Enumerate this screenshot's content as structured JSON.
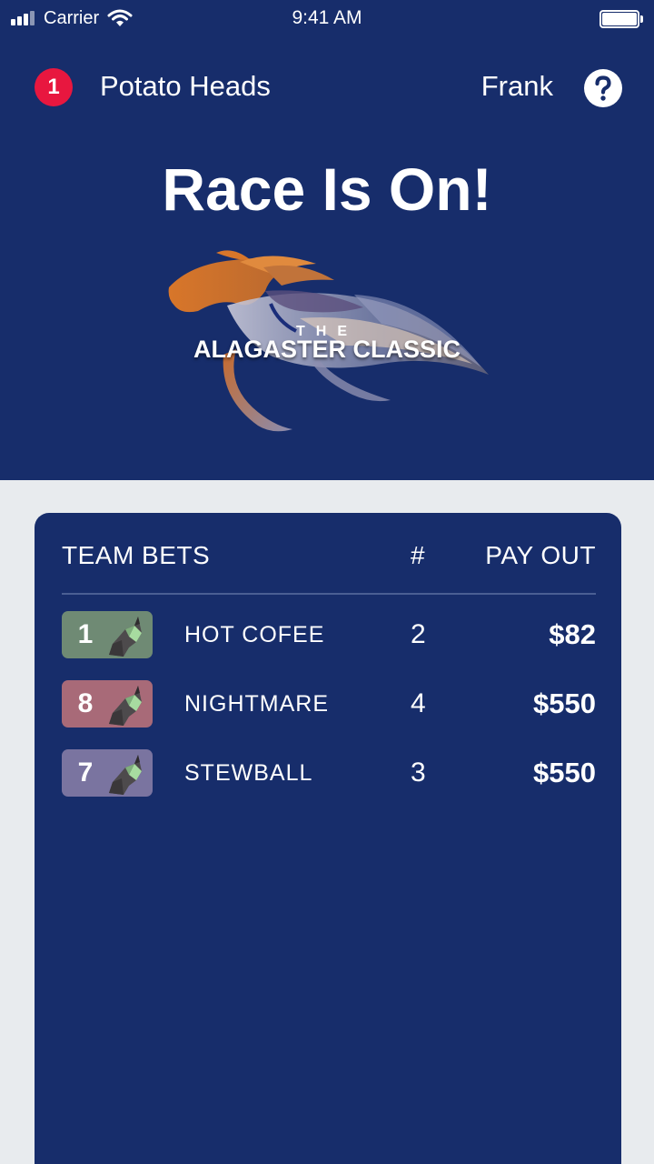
{
  "status_bar": {
    "carrier": "Carrier",
    "time": "9:41 AM"
  },
  "header": {
    "team_rank": "1",
    "team_name": "Potato Heads",
    "user_name": "Frank",
    "help_icon": "question-icon"
  },
  "hero": {
    "headline": "Race Is On!",
    "logo_the": "THE",
    "logo_name": "ALAGASTER CLASSIC"
  },
  "bets": {
    "columns": {
      "team": "TEAM BETS",
      "number": "#",
      "payout": "PAY OUT"
    },
    "rows": [
      {
        "post": "1",
        "name": "HOT COFEE",
        "count": "2",
        "payout": "$82",
        "color": "#6f8a74"
      },
      {
        "post": "8",
        "name": "NIGHTMARE",
        "count": "4",
        "payout": "$550",
        "color": "#a86a78"
      },
      {
        "post": "7",
        "name": "STEWBALL",
        "count": "3",
        "payout": "$550",
        "color": "#7a74a0"
      }
    ]
  },
  "colors": {
    "navy": "#172d6b",
    "background": "#e8ebee",
    "badge_red": "#e8173f"
  }
}
